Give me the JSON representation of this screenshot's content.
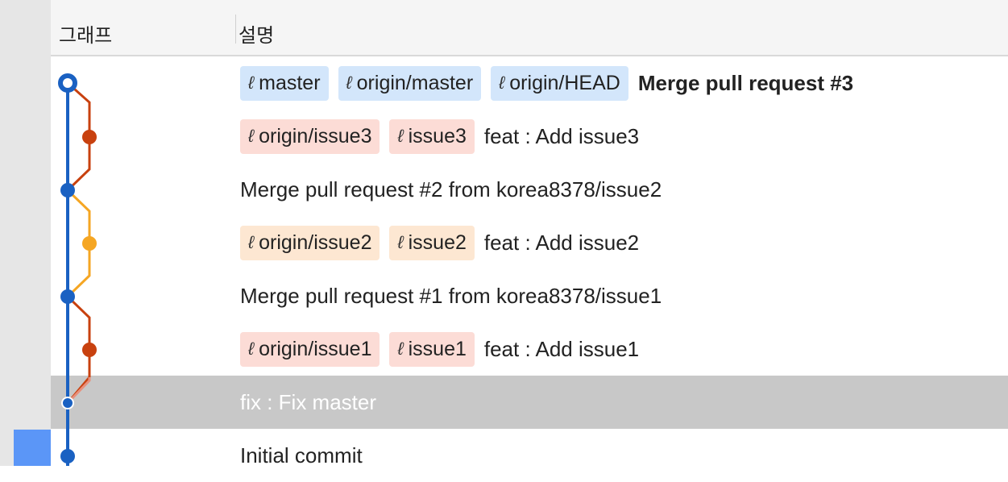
{
  "header": {
    "graph_label": "그래프",
    "desc_label": "설명"
  },
  "icons": {
    "branch": "branch-icon"
  },
  "colors": {
    "blue_line": "#1a61c2",
    "red_line": "#c8410f",
    "orange_line": "#f5a623",
    "pink_line": "#e8907c",
    "tag_blue": "#d3e6fb",
    "tag_red": "#fcdcd6",
    "tag_orange": "#fde7d2"
  },
  "commits": [
    {
      "tags": [
        {
          "label": "master",
          "color": "blue"
        },
        {
          "label": "origin/master",
          "color": "blue"
        },
        {
          "label": "origin/HEAD",
          "color": "blue"
        }
      ],
      "message": "Merge pull request #3",
      "bold": true,
      "selected": false
    },
    {
      "tags": [
        {
          "label": "origin/issue3",
          "color": "red"
        },
        {
          "label": "issue3",
          "color": "red"
        }
      ],
      "message": "feat : Add issue3",
      "bold": false,
      "selected": false
    },
    {
      "tags": [],
      "message": "Merge pull request #2 from korea8378/issue2",
      "bold": false,
      "selected": false
    },
    {
      "tags": [
        {
          "label": "origin/issue2",
          "color": "orange"
        },
        {
          "label": "issue2",
          "color": "orange"
        }
      ],
      "message": "feat : Add issue2",
      "bold": false,
      "selected": false
    },
    {
      "tags": [],
      "message": "Merge pull request #1 from korea8378/issue1",
      "bold": false,
      "selected": false
    },
    {
      "tags": [
        {
          "label": "origin/issue1",
          "color": "red"
        },
        {
          "label": "issue1",
          "color": "red"
        }
      ],
      "message": "feat : Add issue1",
      "bold": false,
      "selected": false
    },
    {
      "tags": [],
      "message": "fix : Fix master",
      "bold": false,
      "selected": true
    },
    {
      "tags": [],
      "message": "Initial commit",
      "bold": false,
      "selected": false
    }
  ]
}
